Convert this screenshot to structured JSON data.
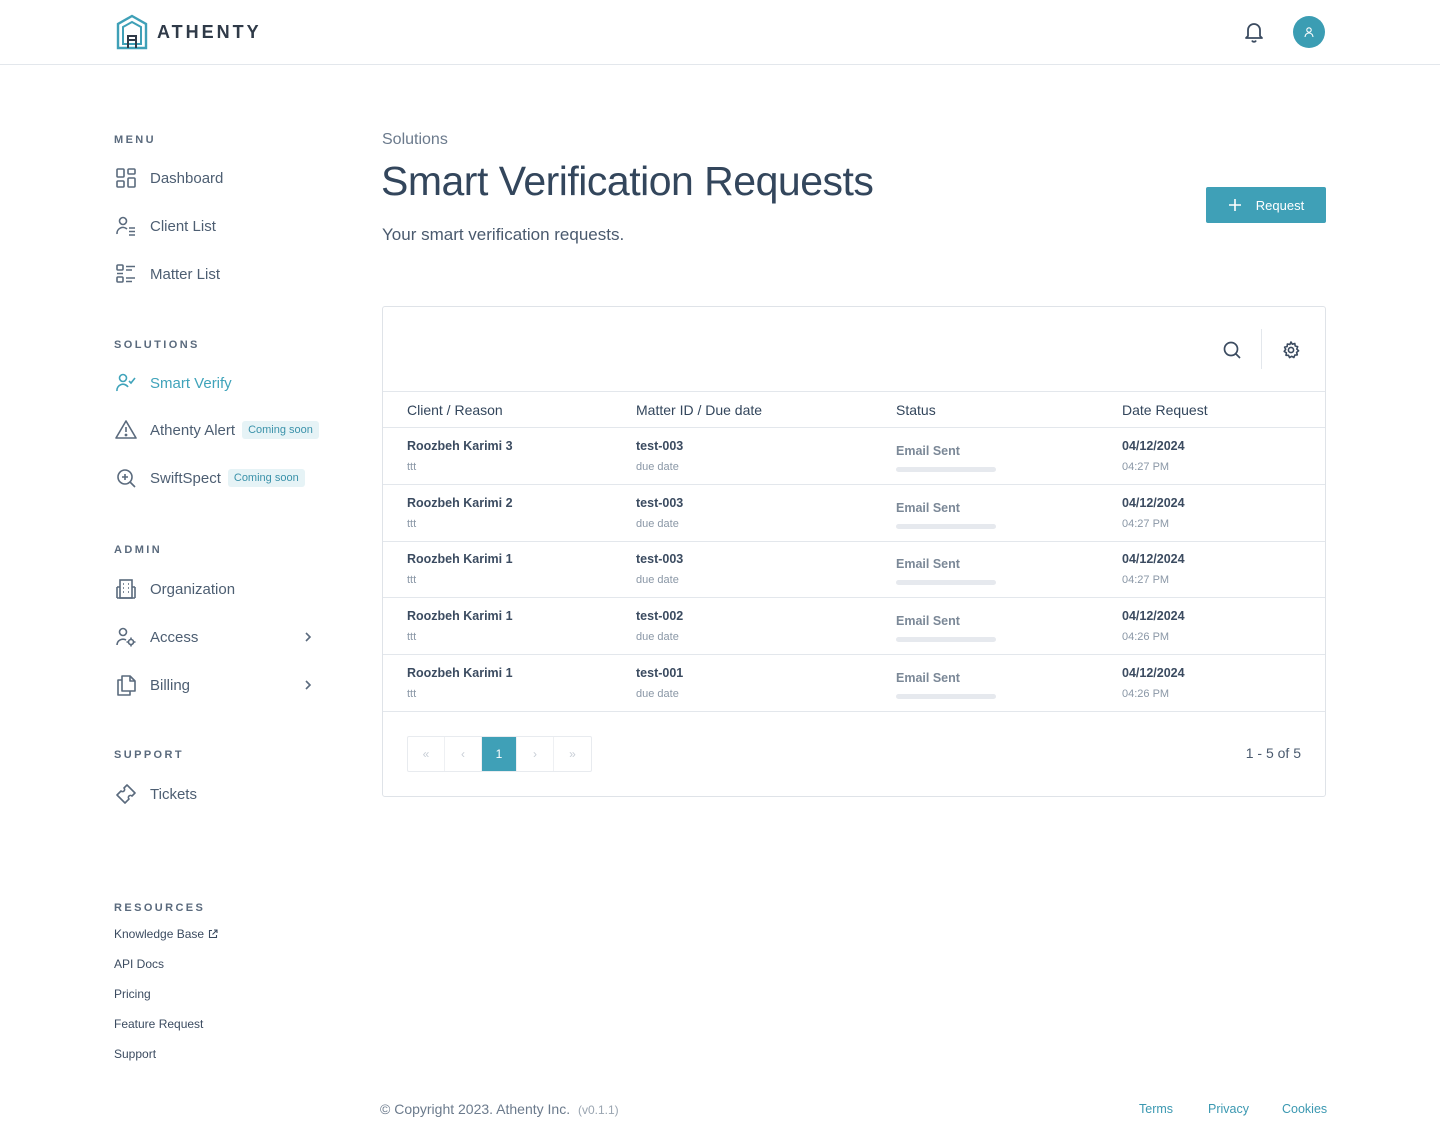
{
  "header": {
    "brand": "ATHENTY",
    "notifications_icon": "bell-icon",
    "avatar_icon": "user-icon",
    "accent": "#3fa0b7"
  },
  "sidebar": {
    "menu_label": "MENU",
    "menu_items": [
      {
        "label": "Dashboard",
        "icon": "grid-icon"
      },
      {
        "label": "Client List",
        "icon": "user-list-icon"
      },
      {
        "label": "Matter List",
        "icon": "list-icon"
      }
    ],
    "solutions_label": "SOLUTIONS",
    "solutions_items": [
      {
        "label": "Smart Verify",
        "icon": "user-check-icon",
        "active": true
      },
      {
        "label": "Athenty Alert",
        "icon": "alert-triangle-icon",
        "badge": "Coming soon"
      },
      {
        "label": "SwiftSpect",
        "icon": "zoom-in-icon",
        "badge": "Coming soon"
      }
    ],
    "admin_label": "ADMIN",
    "admin_items": [
      {
        "label": "Organization",
        "icon": "building-icon"
      },
      {
        "label": "Access",
        "icon": "user-gear-icon"
      },
      {
        "label": "Billing",
        "icon": "documents-icon"
      }
    ],
    "support_label": "SUPPORT",
    "support_items": [
      {
        "label": "Tickets",
        "icon": "ticket-icon"
      }
    ],
    "resources_label": "RESOURCES",
    "resources_links": [
      "Knowledge Base",
      "API Docs",
      "Pricing",
      "Feature Request",
      "Support"
    ]
  },
  "main": {
    "breadcrumb": "Solutions",
    "title": "Smart Verification Requests",
    "subtitle": "Your smart verification requests.",
    "request_button": "Request",
    "table": {
      "columns": [
        "Client / Reason",
        "Matter ID / Due date",
        "Status",
        "Date Request"
      ],
      "rows": [
        {
          "client": "Roozbeh Karimi 3",
          "reason": "ttt",
          "matter": "test-003",
          "due": "due date",
          "status": "Email Sent",
          "date": "04/12/2024",
          "time": "04:27 PM"
        },
        {
          "client": "Roozbeh Karimi 2",
          "reason": "ttt",
          "matter": "test-003",
          "due": "due date",
          "status": "Email Sent",
          "date": "04/12/2024",
          "time": "04:27 PM"
        },
        {
          "client": "Roozbeh Karimi 1",
          "reason": "ttt",
          "matter": "test-003",
          "due": "due date",
          "status": "Email Sent",
          "date": "04/12/2024",
          "time": "04:27 PM"
        },
        {
          "client": "Roozbeh Karimi 1",
          "reason": "ttt",
          "matter": "test-002",
          "due": "due date",
          "status": "Email Sent",
          "date": "04/12/2024",
          "time": "04:26 PM"
        },
        {
          "client": "Roozbeh Karimi 1",
          "reason": "ttt",
          "matter": "test-001",
          "due": "due date",
          "status": "Email Sent",
          "date": "04/12/2024",
          "time": "04:26 PM"
        }
      ]
    },
    "pagination": {
      "first": "«",
      "prev": "‹",
      "current": "1",
      "next": "›",
      "last": "»",
      "range": "1 - 5 of 5"
    }
  },
  "footer": {
    "copyright": "© Copyright 2023. Athenty Inc.",
    "version": "(v0.1.1)",
    "links": [
      "Terms",
      "Privacy",
      "Cookies"
    ]
  }
}
